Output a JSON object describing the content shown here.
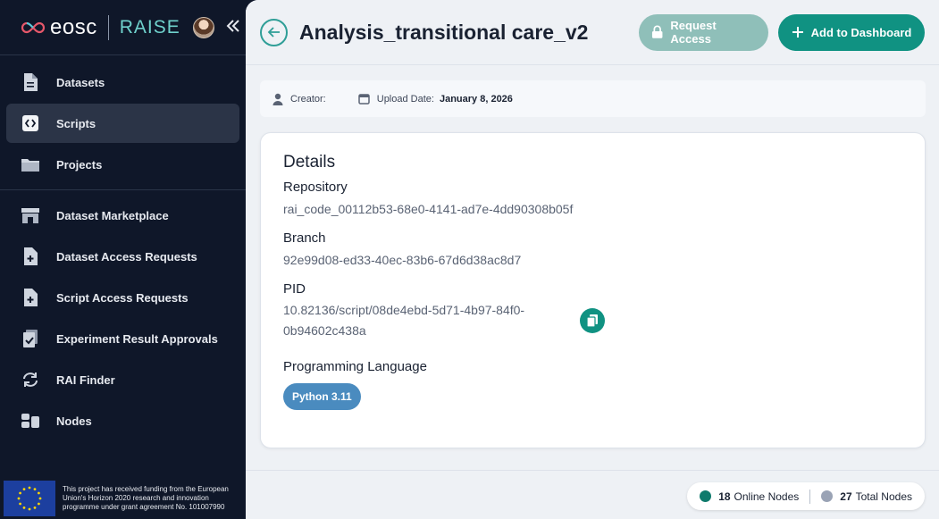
{
  "brand": {
    "eosc": "eosc",
    "raise": "RAISE"
  },
  "sidebar": {
    "items": [
      {
        "label": "Datasets",
        "icon": "file-icon"
      },
      {
        "label": "Scripts",
        "icon": "code-icon",
        "active": true
      },
      {
        "label": "Projects",
        "icon": "folder-icon"
      },
      {
        "label": "Dataset Marketplace",
        "icon": "store-icon"
      },
      {
        "label": "Dataset Access Requests",
        "icon": "file-plus-icon"
      },
      {
        "label": "Script Access Requests",
        "icon": "file-plus-icon"
      },
      {
        "label": "Experiment Result Approvals",
        "icon": "clipboard-check-icon"
      },
      {
        "label": "RAI Finder",
        "icon": "sync-icon"
      },
      {
        "label": "Nodes",
        "icon": "nodes-icon"
      }
    ],
    "funding_text": "This project has received funding from the European Union's Horizon 2020 research and innovation programme under grant agreement No. 101007990"
  },
  "header": {
    "title": "Analysis_transitional care_v2",
    "request_access": "Request Access",
    "add_dashboard": "Add to Dashboard"
  },
  "meta": {
    "creator_label": "Creator:",
    "creator_value": "",
    "upload_label": "Upload Date:",
    "upload_value": "January 8, 2026"
  },
  "details": {
    "title": "Details",
    "repository_label": "Repository",
    "repository_value": "rai_code_00112b53-68e0-4141-ad7e-4dd90308b05f",
    "branch_label": "Branch",
    "branch_value": "92e99d08-ed33-40ec-83b6-67d6d38ac8d7",
    "pid_label": "PID",
    "pid_value": "10.82136/script/08de4ebd-5d71-4b97-84f0-0b94602c438a",
    "language_label": "Programming Language",
    "language_value": "Python 3.11"
  },
  "status": {
    "online_count": "18",
    "online_label": "Online Nodes",
    "total_count": "27",
    "total_label": "Total Nodes",
    "online_color": "#0f7a6c",
    "total_color": "#9aa3b5"
  },
  "colors": {
    "accent": "#109282",
    "sidebar_bg": "#0f1729",
    "badge": "#4a8bbf"
  }
}
